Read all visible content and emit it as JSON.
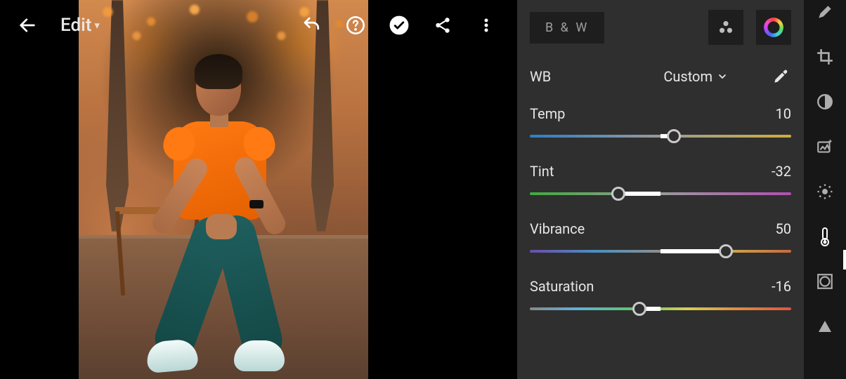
{
  "page_title": "Edit",
  "topbar": {
    "back_icon": "back-arrow-icon",
    "undo_icon": "undo-icon",
    "help_icon": "help-icon",
    "approve_icon": "check-circle-icon",
    "share_icon": "share-icon",
    "more_icon": "more-vert-icon"
  },
  "panel": {
    "bw_label": "B & W",
    "mixer_icon": "mixer-icon",
    "color_ring_icon": "color-ring-icon",
    "wb": {
      "label": "WB",
      "mode": "Custom",
      "picker_icon": "eyedropper-icon"
    },
    "sliders": {
      "temp": {
        "label": "Temp",
        "value": 10,
        "min": -100,
        "max": 100
      },
      "tint": {
        "label": "Tint",
        "value": -32,
        "min": -100,
        "max": 100
      },
      "vibrance": {
        "label": "Vibrance",
        "value": 50,
        "min": -100,
        "max": 100
      },
      "saturation": {
        "label": "Saturation",
        "value": -16,
        "min": -100,
        "max": 100
      }
    }
  },
  "tools": {
    "healing": "healing-brush-icon",
    "crop": "crop-icon",
    "contrast": "contrast-circle-icon",
    "autofix": "auto-photo-icon",
    "light": "light-dial-icon",
    "color": "thermometer-icon",
    "vignette": "vignette-square-icon",
    "detail": "triangle-icon",
    "active": "color"
  },
  "colors": {
    "accent": "#ff7a12",
    "panel_bg": "#2f2f2f",
    "strip_bg": "#171717"
  }
}
